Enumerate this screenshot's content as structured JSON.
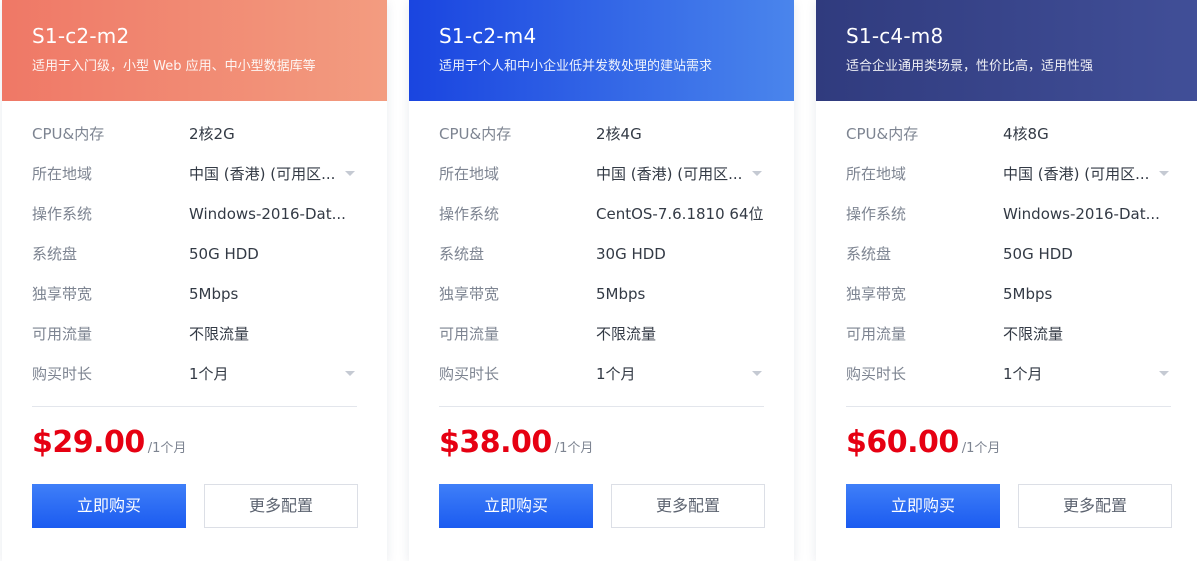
{
  "plans": [
    {
      "title": "S1-c2-m2",
      "description": "适用于入门级，小型 Web 应用、中小型数据库等",
      "header_gradient": [
        "#ef7866",
        "#f39c80"
      ],
      "specs": [
        {
          "label": "CPU&内存",
          "value": "2核2G"
        },
        {
          "label": "所在地域",
          "value": "中国 (香港) (可用区..."
        },
        {
          "label": "操作系统",
          "value": "Windows-2016-Dat..."
        },
        {
          "label": "系统盘",
          "value": "50G HDD"
        },
        {
          "label": "独享带宽",
          "value": "5Mbps"
        },
        {
          "label": "可用流量",
          "value": "不限流量"
        },
        {
          "label": "购买时长",
          "value": "1个月"
        }
      ],
      "price": "$29.00",
      "price_unit": "/1个月",
      "buy_label": "立即购买",
      "more_label": "更多配置"
    },
    {
      "title": "S1-c2-m4",
      "description": "适用于个人和中小企业低并发数处理的建站需求",
      "header_gradient": [
        "#1a45e0",
        "#4a85ec"
      ],
      "specs": [
        {
          "label": "CPU&内存",
          "value": "2核4G"
        },
        {
          "label": "所在地域",
          "value": "中国 (香港) (可用区..."
        },
        {
          "label": "操作系统",
          "value": "CentOS-7.6.1810 64位"
        },
        {
          "label": "系统盘",
          "value": "30G HDD"
        },
        {
          "label": "独享带宽",
          "value": "5Mbps"
        },
        {
          "label": "可用流量",
          "value": "不限流量"
        },
        {
          "label": "购买时长",
          "value": "1个月"
        }
      ],
      "price": "$38.00",
      "price_unit": "/1个月",
      "buy_label": "立即购买",
      "more_label": "更多配置"
    },
    {
      "title": "S1-c4-m8",
      "description": "适合企业通用类场景，性价比高，适用性强",
      "header_gradient": [
        "#303b7e",
        "#414f98"
      ],
      "specs": [
        {
          "label": "CPU&内存",
          "value": "4核8G"
        },
        {
          "label": "所在地域",
          "value": "中国 (香港) (可用区..."
        },
        {
          "label": "操作系统",
          "value": "Windows-2016-Dat..."
        },
        {
          "label": "系统盘",
          "value": "50G HDD"
        },
        {
          "label": "独享带宽",
          "value": "5Mbps"
        },
        {
          "label": "可用流量",
          "value": "不限流量"
        },
        {
          "label": "购买时长",
          "value": "1个月"
        }
      ],
      "price": "$60.00",
      "price_unit": "/1个月",
      "buy_label": "立即购买",
      "more_label": "更多配置"
    }
  ],
  "colors": {
    "price": "#e60012",
    "buy_button": "#2a6cf5",
    "label_text": "#7d8491",
    "value_text": "#333a45",
    "dropdown_arrow": "#c5cad3"
  },
  "icons": {
    "dropdown": "chevron-down-icon"
  }
}
